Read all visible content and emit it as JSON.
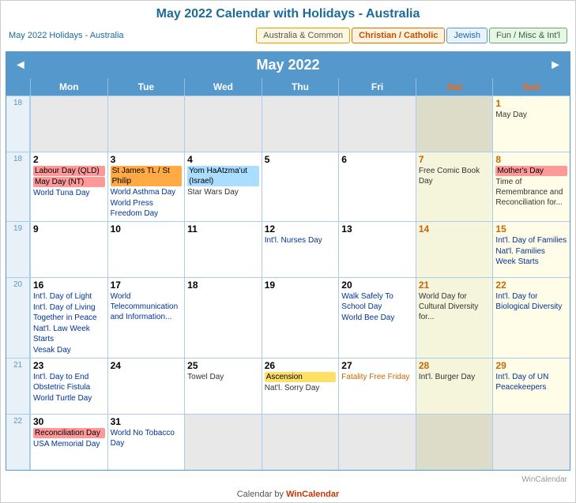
{
  "page": {
    "title": "May 2022 Calendar with Holidays - Australia",
    "subtitle": "May 2022 Holidays - Australia"
  },
  "tabs": [
    {
      "label": "Australia & Common",
      "style": "tab-australia",
      "active": false
    },
    {
      "label": "Christian / Catholic",
      "style": "tab-christian",
      "active": true
    },
    {
      "label": "Jewish",
      "style": "tab-jewish",
      "active": false
    },
    {
      "label": "Fun / Misc & Int'l",
      "style": "tab-fun",
      "active": false
    }
  ],
  "calendar": {
    "month_title": "May 2022",
    "nav_prev": "◄",
    "nav_next": "►",
    "day_headers": [
      "Mon",
      "Tue",
      "Wed",
      "Thu",
      "Fri",
      "Sat",
      "Sun"
    ],
    "weeks": [
      {
        "week_num": "18",
        "days": [
          {
            "num": "",
            "events": [],
            "type": "empty"
          },
          {
            "num": "",
            "events": [],
            "type": "empty"
          },
          {
            "num": "",
            "events": [],
            "type": "empty"
          },
          {
            "num": "",
            "events": [],
            "type": "empty"
          },
          {
            "num": "",
            "events": [],
            "type": "empty"
          },
          {
            "num": "",
            "events": [],
            "type": "empty-sat"
          },
          {
            "num": "1",
            "events": [
              {
                "text": "May Day",
                "style": "plain"
              }
            ],
            "type": "sun"
          }
        ]
      },
      {
        "week_num": "18",
        "days": [
          {
            "num": "2",
            "events": [
              {
                "text": "Labour Day (QLD)",
                "style": "red-bg"
              },
              {
                "text": "May Day (NT)",
                "style": "red-bg"
              },
              {
                "text": "World Tuna Day",
                "style": "blue-text"
              }
            ],
            "type": "mon"
          },
          {
            "num": "3",
            "events": [
              {
                "text": "St James TL / St Philip",
                "style": "orange-bg"
              },
              {
                "text": "World Asthma Day",
                "style": "blue-text"
              },
              {
                "text": "World Press Freedom Day",
                "style": "blue-text"
              }
            ],
            "type": "tue"
          },
          {
            "num": "4",
            "events": [
              {
                "text": "Yom HaAtzma'ut (Israel)",
                "style": "blue-bg"
              },
              {
                "text": "Star Wars Day",
                "style": "plain"
              }
            ],
            "type": "wed"
          },
          {
            "num": "5",
            "events": [],
            "type": "thu"
          },
          {
            "num": "6",
            "events": [],
            "type": "fri"
          },
          {
            "num": "7",
            "events": [
              {
                "text": "Free Comic Book Day",
                "style": "plain"
              }
            ],
            "type": "sat"
          },
          {
            "num": "8",
            "events": [
              {
                "text": "Mother's Day",
                "style": "red-bg"
              },
              {
                "text": "Time of Remembrance and Reconciliation for...",
                "style": "plain"
              }
            ],
            "type": "sun"
          }
        ]
      },
      {
        "week_num": "19",
        "days": [
          {
            "num": "9",
            "events": [],
            "type": "mon"
          },
          {
            "num": "10",
            "events": [],
            "type": "tue"
          },
          {
            "num": "11",
            "events": [],
            "type": "wed"
          },
          {
            "num": "12",
            "events": [
              {
                "text": "Int'l. Nurses Day",
                "style": "blue-text"
              }
            ],
            "type": "thu"
          },
          {
            "num": "13",
            "events": [],
            "type": "fri"
          },
          {
            "num": "14",
            "events": [],
            "type": "sat"
          },
          {
            "num": "15",
            "events": [
              {
                "text": "Int'l. Day of Families",
                "style": "blue-text"
              },
              {
                "text": "Nat'l. Families Week Starts",
                "style": "blue-text"
              }
            ],
            "type": "sun"
          }
        ]
      },
      {
        "week_num": "20",
        "days": [
          {
            "num": "16",
            "events": [
              {
                "text": "Int'l. Day of Light",
                "style": "blue-text"
              },
              {
                "text": "Int'l. Day of Living Together in Peace",
                "style": "blue-text"
              },
              {
                "text": "Nat'l. Law Week Starts",
                "style": "blue-text"
              },
              {
                "text": "Vesak Day",
                "style": "blue-text"
              }
            ],
            "type": "mon"
          },
          {
            "num": "17",
            "events": [
              {
                "text": "World Telecommunication and Information...",
                "style": "blue-text"
              }
            ],
            "type": "tue"
          },
          {
            "num": "18",
            "events": [],
            "type": "wed"
          },
          {
            "num": "19",
            "events": [],
            "type": "thu"
          },
          {
            "num": "20",
            "events": [
              {
                "text": "Walk Safely To School Day",
                "style": "blue-text"
              },
              {
                "text": "World Bee Day",
                "style": "blue-text"
              }
            ],
            "type": "fri"
          },
          {
            "num": "21",
            "events": [
              {
                "text": "World Day for Cultural Diversity for...",
                "style": "plain"
              }
            ],
            "type": "sat"
          },
          {
            "num": "22",
            "events": [
              {
                "text": "Int'l. Day for Biological Diversity",
                "style": "blue-text"
              }
            ],
            "type": "sun"
          }
        ]
      },
      {
        "week_num": "21",
        "days": [
          {
            "num": "23",
            "events": [
              {
                "text": "Int'l. Day to End Obstetric Fistula",
                "style": "blue-text"
              },
              {
                "text": "World Turtle Day",
                "style": "blue-text"
              }
            ],
            "type": "mon"
          },
          {
            "num": "24",
            "events": [],
            "type": "tue"
          },
          {
            "num": "25",
            "events": [
              {
                "text": "Towel Day",
                "style": "plain"
              }
            ],
            "type": "wed"
          },
          {
            "num": "26",
            "events": [
              {
                "text": "Ascension",
                "style": "yellow-bg"
              },
              {
                "text": "Nat'l. Sorry Day",
                "style": "plain"
              }
            ],
            "type": "thu"
          },
          {
            "num": "27",
            "events": [
              {
                "text": "Fatality Free Friday",
                "style": "orange-text"
              }
            ],
            "type": "fri"
          },
          {
            "num": "28",
            "events": [
              {
                "text": "Int'l. Burger Day",
                "style": "plain"
              }
            ],
            "type": "sat"
          },
          {
            "num": "29",
            "events": [
              {
                "text": "Int'l. Day of UN Peacekeepers",
                "style": "blue-text"
              }
            ],
            "type": "sun"
          }
        ]
      },
      {
        "week_num": "22",
        "days": [
          {
            "num": "30",
            "events": [
              {
                "text": "Reconciliation Day",
                "style": "red-bg"
              },
              {
                "text": "USA Memorial Day",
                "style": "blue-text"
              }
            ],
            "type": "mon"
          },
          {
            "num": "31",
            "events": [
              {
                "text": "World No Tobacco Day",
                "style": "blue-text"
              }
            ],
            "type": "tue"
          },
          {
            "num": "",
            "events": [],
            "type": "empty"
          },
          {
            "num": "",
            "events": [],
            "type": "empty"
          },
          {
            "num": "",
            "events": [],
            "type": "empty"
          },
          {
            "num": "",
            "events": [],
            "type": "empty-sat"
          },
          {
            "num": "",
            "events": [],
            "type": "empty-sun"
          }
        ]
      }
    ]
  },
  "footer": {
    "text": "Calendar by ",
    "link_text": "WinCalendar",
    "wincalendar_credit": "WinCalendar"
  }
}
